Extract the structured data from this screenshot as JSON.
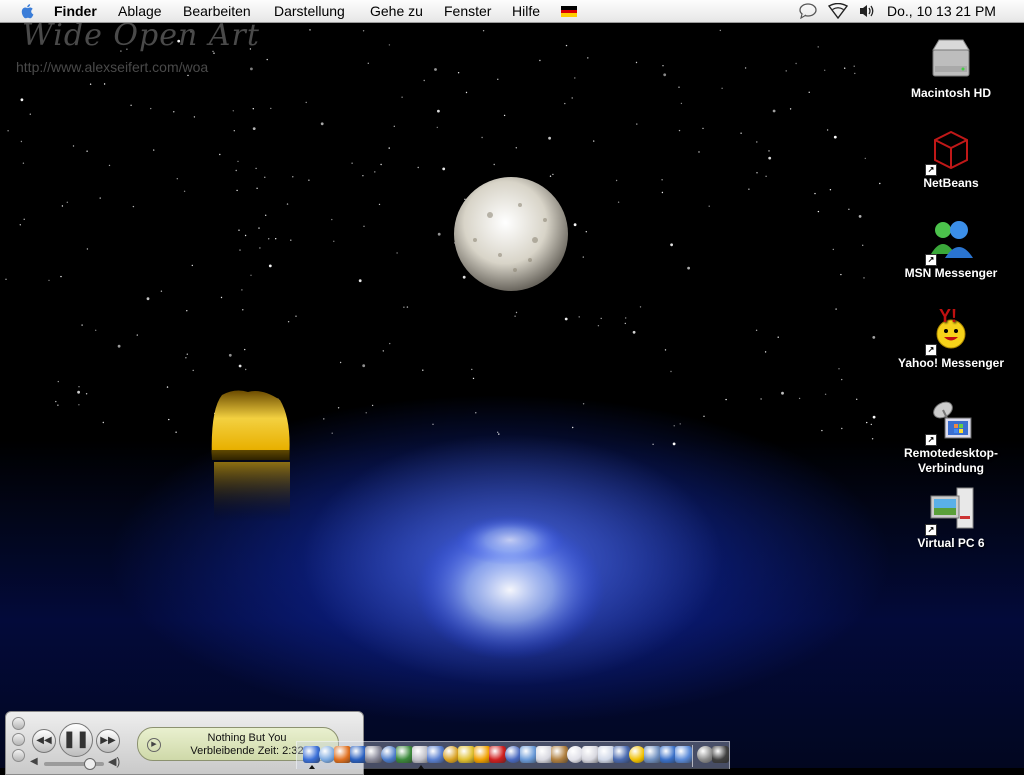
{
  "menubar": {
    "menus": [
      "Finder",
      "Ablage",
      "Bearbeiten",
      "Darstellung",
      "Gehe zu",
      "Fenster",
      "Hilfe"
    ],
    "clock": "Do., 10 13 21 PM",
    "keyboard_flag": [
      "#000000",
      "#dd0000",
      "#ffce00"
    ]
  },
  "wallpaper": {
    "title": "Wide Open Art",
    "url": "http://www.alexseifert.com/woa"
  },
  "desktop_icons": [
    {
      "label": "Macintosh HD",
      "icon": "hard-drive-icon"
    },
    {
      "label": "NetBeans",
      "icon": "netbeans-cube-icon"
    },
    {
      "label": "MSN Messenger",
      "icon": "msn-buddies-icon"
    },
    {
      "label": "Yahoo! Messenger",
      "icon": "yahoo-smiley-icon"
    },
    {
      "label": "Remotedesktop-Verbindung",
      "label_lines": [
        "Remotedesktop-",
        "Verbindung"
      ],
      "icon": "remote-desktop-icon"
    },
    {
      "label": "Virtual PC 6",
      "icon": "virtual-pc-icon"
    }
  ],
  "itunes": {
    "track": "Nothing But You",
    "remaining": "Verbleibende Zeit: 2:32",
    "volume": 0.75
  },
  "dock": {
    "colors": [
      "#3a6fd8",
      "#7aa8e0",
      "#e07020",
      "#2a60c0",
      "#8a8a9a",
      "#4a7ac8",
      "#3c8a3c",
      "#c0c0c8",
      "#5a80d0",
      "#d8a020",
      "#e0c030",
      "#f0a000",
      "#d02020",
      "#4a6ac0",
      "#6a9ad8",
      "#d8d8e0",
      "#b08040",
      "#e0e0e8",
      "#d8d8e0",
      "#d0d8e8",
      "#4a6ab0",
      "#f0c000",
      "#7090c0",
      "#3a70c8",
      "#5a8ad8",
      "#8a8a8a",
      "#404040"
    ]
  }
}
